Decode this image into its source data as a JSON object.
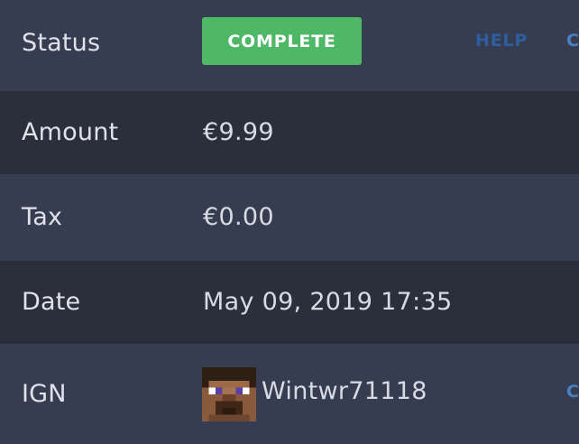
{
  "rows": {
    "status": {
      "label": "Status",
      "badge": "COMPLETE",
      "badge_color": "#4fb866"
    },
    "amount": {
      "label": "Amount",
      "value": "€9.99"
    },
    "tax": {
      "label": "Tax",
      "value": "€0.00"
    },
    "date": {
      "label": "Date",
      "value": "May 09, 2019 17:35"
    },
    "ign": {
      "label": "IGN",
      "value": "Wintwr71118",
      "avatar_icon": "player-head-icon"
    }
  },
  "links": {
    "help": "HELP",
    "status_edge": "C",
    "ign_edge": "C"
  },
  "colors": {
    "background": "#373d51",
    "row_alt": "#2b2f3b",
    "link": "#2f5e9e"
  }
}
